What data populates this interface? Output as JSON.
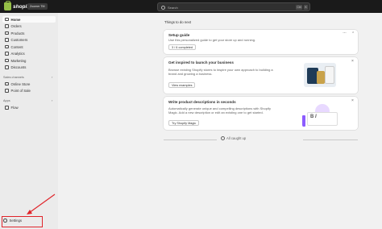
{
  "topbar": {
    "brand": "shopify",
    "store": "Zoomer TM",
    "search_placeholder": "Search",
    "shortcut": [
      "Ctrl",
      "K"
    ]
  },
  "sidebar": {
    "items": [
      {
        "label": "Home",
        "icon": "home-icon"
      },
      {
        "label": "Orders",
        "icon": "orders-icon"
      },
      {
        "label": "Products",
        "icon": "tag-icon"
      },
      {
        "label": "Customers",
        "icon": "person-icon"
      },
      {
        "label": "Content",
        "icon": "content-icon"
      },
      {
        "label": "Analytics",
        "icon": "chart-icon"
      },
      {
        "label": "Marketing",
        "icon": "target-icon"
      },
      {
        "label": "Discounts",
        "icon": "discount-icon"
      }
    ],
    "sales_channels_label": "Sales channels",
    "channels": [
      {
        "label": "Online Store"
      },
      {
        "label": "Point of Sale"
      }
    ],
    "apps_label": "Apps",
    "apps": [
      {
        "label": "Flow"
      }
    ],
    "settings_label": "Settings"
  },
  "main": {
    "heading": "Things to do next",
    "cards": [
      {
        "title": "Setup guide",
        "desc": "Use this personalized guide to get your store up and running.",
        "button": "3 / 6 completed"
      },
      {
        "title": "Get inspired to launch your business",
        "desc": "Browse existing Shopify stores to inspire your own approach to building a brand and growing a business.",
        "button": "View examples"
      },
      {
        "title": "Write product descriptions in seconds",
        "desc": "Automatically generate unique and compelling descriptions with Shopify Magic. Add a new description or edit an existing one to get started.",
        "button": "Try Shopify Magic"
      }
    ],
    "caught_up": "All caught up"
  },
  "colors": {
    "accent": "#e0242a",
    "brand": "#95bf47",
    "topbar": "#1a1a1a",
    "sidebar": "#ebebeb"
  }
}
